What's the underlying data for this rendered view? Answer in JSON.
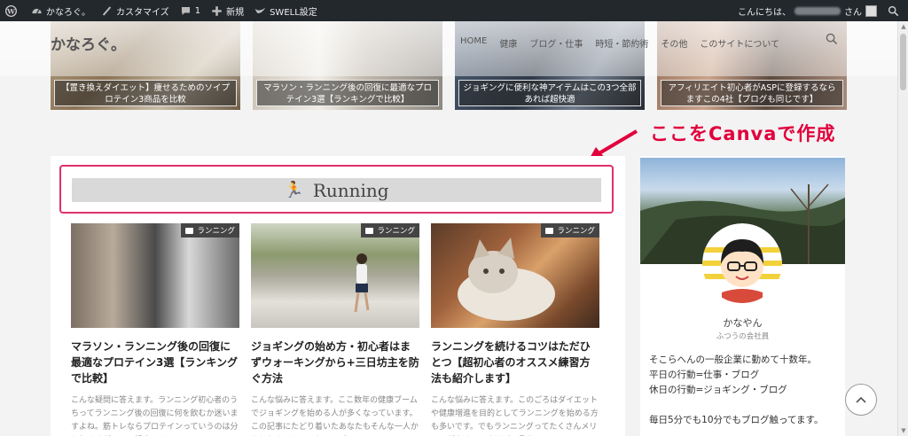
{
  "admin_bar": {
    "site_name": "かなろぐ。",
    "customize": "カスタマイズ",
    "comments_count": "1",
    "new": "新規",
    "swell": "SWELL設定",
    "greeting": "こんにちは、",
    "honorific": "さん"
  },
  "header": {
    "logo": "かなろぐ。",
    "nav": [
      "HOME",
      "健康",
      "ブログ・仕事",
      "時短・節約術",
      "その他",
      "このサイトについて"
    ]
  },
  "pickup": [
    "【置き換えダイエット】痩せるためのソイプロテイン3商品を比較",
    "マラソン・ランニング後の回復に最適なプロテイン3選【ランキングで比較】",
    "ジョギングに便利な神アイテムはこの3つ全部あれば超快適",
    "アフィリエイト初心者がASPに登録するならますこの4社【ブログも同じです】"
  ],
  "annotation": {
    "text": "ここをCanvaで作成",
    "color": "#e1003c"
  },
  "section": {
    "title": "Running"
  },
  "posts": [
    {
      "category": "ランニング",
      "title": "マラソン・ランニング後の回復に最適なプロテイン3選【ランキングで比較】",
      "excerpt": "こんな疑問に答えます。ランニング初心者のうちってランニング後の回復に何を飲むか迷いますよね。筋トレならプロテインっていうのは分かりますが、この記事では"
    },
    {
      "category": "ランニング",
      "title": "ジョギングの始め方・初心者はまずウォーキングから+三日坊主を防ぐ方法",
      "excerpt": "こんな悩みに答えます。ここ数年の健康ブームでジョギングを始める人が多くなっています。この記事にたどり着いたあなたもそんな一人かもしれません。でもジョギ"
    },
    {
      "category": "ランニング",
      "title": "ランニングを続けるコツはただひとつ【超初心者のオススメ練習方法も紹介します】",
      "excerpt": "こんな悩みに答えます。このごろはダイエットや健康増進を目的としてランニングを始める方も多いです。でもランニングってたくさんメリットがあるんですけど、鼻炎"
    }
  ],
  "profile": {
    "name": "かなやん",
    "role": "ふつうの会社員",
    "bio": [
      "そこらへんの一般企業に勤めて十数年。",
      "平日の行動=仕事・ブログ",
      "休日の行動=ジョギング・ブログ"
    ],
    "bio2": "毎日5分でも10分でもブログ触ってます。"
  },
  "icons": {
    "wp": "wordpress-icon",
    "search": "search-icon",
    "to_top": "chevron-up-icon"
  }
}
